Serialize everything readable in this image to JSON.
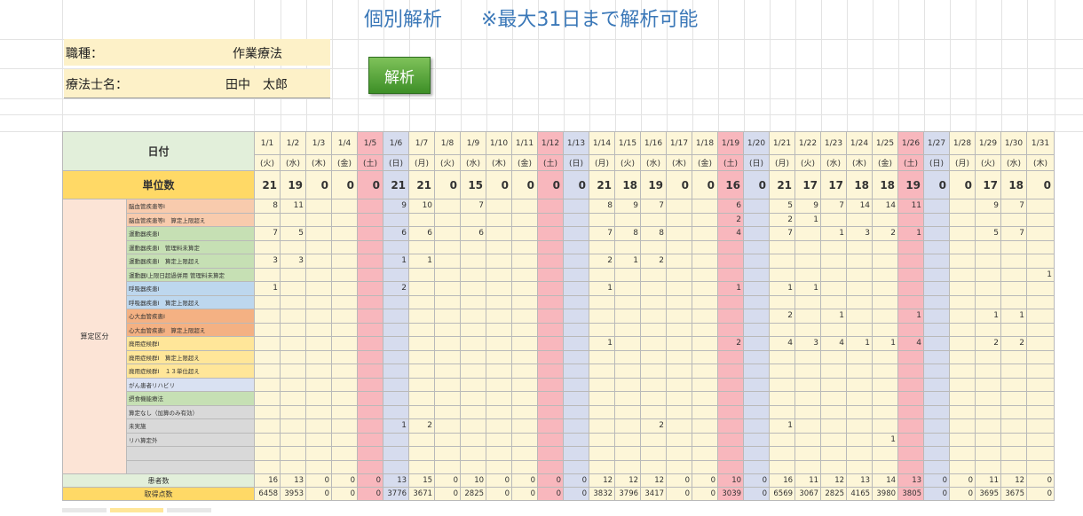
{
  "page": {
    "title": "個別解析　　※最大31日まで解析可能",
    "occupation_label": "職種：",
    "occupation_value": "作業療法",
    "therapist_label": "療法士名：",
    "therapist_value": "田中　太郎",
    "analyze_button": "解析"
  },
  "grid": {
    "date_header": "日付",
    "units_header": "単位数",
    "category_header": "算定区分",
    "patients_header": "患者数",
    "points_header": "取得点数",
    "dates": [
      "1/1",
      "1/2",
      "1/3",
      "1/4",
      "1/5",
      "1/6",
      "1/7",
      "1/8",
      "1/9",
      "1/10",
      "1/11",
      "1/12",
      "1/13",
      "1/14",
      "1/15",
      "1/16",
      "1/17",
      "1/18",
      "1/19",
      "1/20",
      "1/21",
      "1/22",
      "1/23",
      "1/24",
      "1/25",
      "1/26",
      "1/27",
      "1/28",
      "1/29",
      "1/30",
      "1/31"
    ],
    "weekdays": [
      "(火)",
      "(水)",
      "(木)",
      "(金)",
      "(土)",
      "(日)",
      "(月)",
      "(火)",
      "(水)",
      "(木)",
      "(金)",
      "(土)",
      "(日)",
      "(月)",
      "(火)",
      "(水)",
      "(木)",
      "(金)",
      "(土)",
      "(日)",
      "(月)",
      "(火)",
      "(水)",
      "(木)",
      "(金)",
      "(土)",
      "(日)",
      "(月)",
      "(火)",
      "(水)",
      "(木)"
    ],
    "units": [
      "21",
      "19",
      "0",
      "0",
      "0",
      "21",
      "21",
      "0",
      "15",
      "0",
      "0",
      "0",
      "0",
      "21",
      "18",
      "19",
      "0",
      "0",
      "16",
      "0",
      "21",
      "17",
      "17",
      "18",
      "18",
      "19",
      "0",
      "0",
      "17",
      "18",
      "0"
    ],
    "rows": [
      {
        "label": "脳血管疾患等Ⅰ",
        "color": "#f8cbad",
        "values": [
          "8",
          "11",
          "",
          "",
          "",
          "9",
          "10",
          "",
          "7",
          "",
          "",
          "",
          "",
          "8",
          "9",
          "7",
          "",
          "",
          "6",
          "",
          "5",
          "9",
          "7",
          "14",
          "14",
          "11",
          "",
          "",
          "9",
          "7",
          ""
        ]
      },
      {
        "label": "脳血管疾患等Ⅰ　算定上限超え",
        "color": "#f8cbad",
        "values": [
          "",
          "",
          "",
          "",
          "",
          "",
          "",
          "",
          "",
          "",
          "",
          "",
          "",
          "",
          "",
          "",
          "",
          "",
          "2",
          "",
          "2",
          "1",
          "",
          "",
          "",
          "",
          "",
          "",
          "",
          "",
          ""
        ]
      },
      {
        "label": "運動器疾患Ⅰ",
        "color": "#c6e0b4",
        "values": [
          "7",
          "5",
          "",
          "",
          "",
          "6",
          "6",
          "",
          "6",
          "",
          "",
          "",
          "",
          "7",
          "8",
          "8",
          "",
          "",
          "4",
          "",
          "7",
          "",
          "1",
          "3",
          "2",
          "1",
          "",
          "",
          "5",
          "7",
          ""
        ]
      },
      {
        "label": "運動器疾患Ⅰ　管理料未算定",
        "color": "#c6e0b4",
        "values": [
          "",
          "",
          "",
          "",
          "",
          "",
          "",
          "",
          "",
          "",
          "",
          "",
          "",
          "",
          "",
          "",
          "",
          "",
          "",
          "",
          "",
          "",
          "",
          "",
          "",
          "",
          "",
          "",
          "",
          "",
          ""
        ]
      },
      {
        "label": "運動器疾患Ⅰ　算定上限超え",
        "color": "#c6e0b4",
        "values": [
          "3",
          "3",
          "",
          "",
          "",
          "1",
          "1",
          "",
          "",
          "",
          "",
          "",
          "",
          "2",
          "1",
          "2",
          "",
          "",
          "",
          "",
          "",
          "",
          "",
          "",
          "",
          "",
          "",
          "",
          "",
          "",
          ""
        ]
      },
      {
        "label": "運動器Ⅰ上限日超過併用 管理料未算定",
        "color": "#c6e0b4",
        "values": [
          "",
          "",
          "",
          "",
          "",
          "",
          "",
          "",
          "",
          "",
          "",
          "",
          "",
          "",
          "",
          "",
          "",
          "",
          "",
          "",
          "",
          "",
          "",
          "",
          "",
          "",
          "",
          "",
          "",
          "",
          "1"
        ]
      },
      {
        "label": "呼吸器疾患Ⅰ",
        "color": "#bdd7ee",
        "values": [
          "1",
          "",
          "",
          "",
          "",
          "2",
          "",
          "",
          "",
          "",
          "",
          "",
          "",
          "1",
          "",
          "",
          "",
          "",
          "1",
          "",
          "1",
          "1",
          "",
          "",
          "",
          "",
          "",
          "",
          "",
          "",
          ""
        ]
      },
      {
        "label": "呼吸器疾患Ⅰ　算定上限超え",
        "color": "#bdd7ee",
        "values": [
          "",
          "",
          "",
          "",
          "",
          "",
          "",
          "",
          "",
          "",
          "",
          "",
          "",
          "",
          "",
          "",
          "",
          "",
          "",
          "",
          "",
          "",
          "",
          "",
          "",
          "",
          "",
          "",
          "",
          "",
          ""
        ]
      },
      {
        "label": "心大血管疾患Ⅰ",
        "color": "#f4b183",
        "values": [
          "",
          "",
          "",
          "",
          "",
          "",
          "",
          "",
          "",
          "",
          "",
          "",
          "",
          "",
          "",
          "",
          "",
          "",
          "",
          "",
          "2",
          "",
          "1",
          "",
          "",
          "1",
          "",
          "",
          "1",
          "1",
          ""
        ]
      },
      {
        "label": "心大血管疾患Ⅰ　算定上限超え",
        "color": "#f4b183",
        "values": [
          "",
          "",
          "",
          "",
          "",
          "",
          "",
          "",
          "",
          "",
          "",
          "",
          "",
          "",
          "",
          "",
          "",
          "",
          "",
          "",
          "",
          "",
          "",
          "",
          "",
          "",
          "",
          "",
          "",
          "",
          ""
        ]
      },
      {
        "label": "廃用症候群Ⅰ",
        "color": "#ffe699",
        "values": [
          "",
          "",
          "",
          "",
          "",
          "",
          "",
          "",
          "",
          "",
          "",
          "",
          "",
          "1",
          "",
          "",
          "",
          "",
          "2",
          "",
          "4",
          "3",
          "4",
          "1",
          "1",
          "4",
          "",
          "",
          "2",
          "2",
          ""
        ]
      },
      {
        "label": "廃用症候群Ⅰ　算定上限超え",
        "color": "#ffe699",
        "values": [
          "",
          "",
          "",
          "",
          "",
          "",
          "",
          "",
          "",
          "",
          "",
          "",
          "",
          "",
          "",
          "",
          "",
          "",
          "",
          "",
          "",
          "",
          "",
          "",
          "",
          "",
          "",
          "",
          "",
          "",
          ""
        ]
      },
      {
        "label": "廃用症候群Ⅰ　１３単位超え",
        "color": "#ffe699",
        "values": [
          "",
          "",
          "",
          "",
          "",
          "",
          "",
          "",
          "",
          "",
          "",
          "",
          "",
          "",
          "",
          "",
          "",
          "",
          "",
          "",
          "",
          "",
          "",
          "",
          "",
          "",
          "",
          "",
          "",
          "",
          ""
        ]
      },
      {
        "label": "がん患者リハビリ",
        "color": "#d9e1f2",
        "values": [
          "",
          "",
          "",
          "",
          "",
          "",
          "",
          "",
          "",
          "",
          "",
          "",
          "",
          "",
          "",
          "",
          "",
          "",
          "",
          "",
          "",
          "",
          "",
          "",
          "",
          "",
          "",
          "",
          "",
          "",
          ""
        ]
      },
      {
        "label": "摂食機能療法",
        "color": "#c6e0b4",
        "values": [
          "",
          "",
          "",
          "",
          "",
          "",
          "",
          "",
          "",
          "",
          "",
          "",
          "",
          "",
          "",
          "",
          "",
          "",
          "",
          "",
          "",
          "",
          "",
          "",
          "",
          "",
          "",
          "",
          "",
          "",
          ""
        ]
      },
      {
        "label": "算定なし（加算のみ有効）",
        "color": "#d9d9d9",
        "values": [
          "",
          "",
          "",
          "",
          "",
          "",
          "",
          "",
          "",
          "",
          "",
          "",
          "",
          "",
          "",
          "",
          "",
          "",
          "",
          "",
          "",
          "",
          "",
          "",
          "",
          "",
          "",
          "",
          "",
          "",
          ""
        ]
      },
      {
        "label": "未実施",
        "color": "#d9d9d9",
        "values": [
          "",
          "",
          "",
          "",
          "",
          "1",
          "2",
          "",
          "",
          "",
          "",
          "",
          "",
          "",
          "",
          "2",
          "",
          "",
          "",
          "",
          "1",
          "",
          "",
          "",
          "",
          "",
          "",
          "",
          "",
          "",
          ""
        ]
      },
      {
        "label": "リハ算定外",
        "color": "#d9d9d9",
        "values": [
          "",
          "",
          "",
          "",
          "",
          "",
          "",
          "",
          "",
          "",
          "",
          "",
          "",
          "",
          "",
          "",
          "",
          "",
          "",
          "",
          "",
          "",
          "",
          "",
          "1",
          "",
          "",
          "",
          "",
          "",
          ""
        ]
      },
      {
        "label": "",
        "color": "#d9d9d9",
        "values": [
          "",
          "",
          "",
          "",
          "",
          "",
          "",
          "",
          "",
          "",
          "",
          "",
          "",
          "",
          "",
          "",
          "",
          "",
          "",
          "",
          "",
          "",
          "",
          "",
          "",
          "",
          "",
          "",
          "",
          "",
          ""
        ]
      },
      {
        "label": "",
        "color": "#d9d9d9",
        "values": [
          "",
          "",
          "",
          "",
          "",
          "",
          "",
          "",
          "",
          "",
          "",
          "",
          "",
          "",
          "",
          "",
          "",
          "",
          "",
          "",
          "",
          "",
          "",
          "",
          "",
          "",
          "",
          "",
          "",
          "",
          ""
        ]
      }
    ],
    "patients": [
      "16",
      "13",
      "0",
      "0",
      "0",
      "13",
      "15",
      "0",
      "10",
      "0",
      "0",
      "0",
      "0",
      "12",
      "12",
      "12",
      "0",
      "0",
      "10",
      "0",
      "16",
      "11",
      "12",
      "13",
      "14",
      "13",
      "0",
      "0",
      "11",
      "12",
      "0"
    ],
    "points": [
      "6458",
      "3953",
      "0",
      "0",
      "0",
      "3776",
      "3671",
      "0",
      "2825",
      "0",
      "0",
      "0",
      "0",
      "3832",
      "3796",
      "3417",
      "0",
      "0",
      "3039",
      "0",
      "6569",
      "3067",
      "2825",
      "4165",
      "3980",
      "3805",
      "0",
      "0",
      "3695",
      "3675",
      "0"
    ]
  },
  "colors": {
    "saturday": "#f8b7bd",
    "sunday": "#d6dcee",
    "weekday": "#fdf6d8",
    "date_header_bg": "#e2efda",
    "units_header_bg": "#ffd966",
    "category_bg": "#fce4d6",
    "button": "#5aa83a",
    "title": "#3b78b8"
  }
}
